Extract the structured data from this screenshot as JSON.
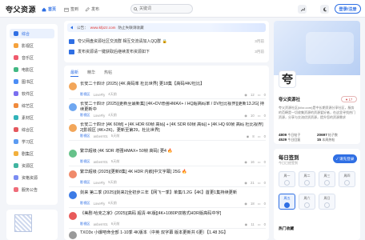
{
  "header": {
    "logo": "夸父资源",
    "nav": [
      {
        "label": "首页",
        "active": true
      },
      {
        "label": "签到",
        "active": false
      },
      {
        "label": "发布",
        "active": false
      }
    ],
    "search_placeholder": "关键词",
    "login_label": "登录/注册"
  },
  "sidebar": {
    "items": [
      {
        "label": "综合",
        "color": "#2f6fe4"
      },
      {
        "label": "影视区",
        "color": "#f5a23c"
      },
      {
        "label": "音乐区",
        "color": "#ef5b6d"
      },
      {
        "label": "电影区",
        "color": "#42b883"
      },
      {
        "label": "图书区",
        "color": "#4c8df6"
      },
      {
        "label": "软件区",
        "color": "#7a6ff0"
      },
      {
        "label": "综艺区",
        "color": "#f08a3c"
      },
      {
        "label": "素材区",
        "color": "#31b3b9"
      },
      {
        "label": "综合区",
        "color": "#e4585e"
      },
      {
        "label": "学习区",
        "color": "#5b9bf2"
      },
      {
        "label": "剧集区",
        "color": "#f2b03c"
      },
      {
        "label": "资源区",
        "color": "#40b4a0"
      },
      {
        "label": "资格资源",
        "color": "#7b8cf2"
      },
      {
        "label": "服务公告",
        "color": "#ef6d7a"
      }
    ]
  },
  "notice": {
    "bar_prefix": "公告：",
    "bar_url": "www.kfpzz.com",
    "bar_text": "防止失联请收藏",
    "rows": [
      {
        "text": "夸父网盘资源社区交流群 相互交流请加入QQ群 🔒",
        "date": "3月前"
      },
      {
        "text": "发布资源请一键获取后继续发布资源如下",
        "date": "3月前"
      }
    ]
  },
  "posts": {
    "tabs": [
      {
        "label": "最新",
        "active": true
      },
      {
        "label": "精华",
        "active": false
      },
      {
        "label": "热帖",
        "active": false
      }
    ],
    "items": [
      {
        "title": "长安二十四计 (2025) [4K 高码率 杜比世界] 更18集【高码/4K/杜比】",
        "two": false,
        "cat": "影视区",
        "user": "LoveFly",
        "time": "4天前",
        "views": "12",
        "replies": "0",
        "avatar": "#f2a65a"
      },
      {
        "title": "长安二十四计 (2025)[更新至最新集] [4K+DV增强HMAX+ / HQ超高码率 / DV杜比视界][更新13.2G] 持续更新中",
        "two": true,
        "cat": "影视区",
        "user": "LoveFly",
        "time": "4天前",
        "views": "10",
        "replies": "0",
        "avatar": "#6fa7f0"
      },
      {
        "title": "长安二十四计 [4K 60帧] + [4K HDR 60帧 高码] + [4K SDR 60帧 高码] + [4K HQ 60帧 高码 杜比视界] 2[影视区 (4K+2K)，更新至第29，杜比世界]",
        "two": true,
        "cat": "影视区",
        "user": "anberrr01",
        "time": "5天前",
        "views": "8",
        "replies": "0",
        "avatar": "#f2a65a"
      },
      {
        "title": "繁华超级 (4K SDR 增强HMAX+ 50帧 高码) 更4 🔥",
        "two": false,
        "cat": "影视区",
        "user": "anberrr01",
        "time": "5天前",
        "views": "16",
        "replies": "0",
        "avatar": "#66c28a"
      },
      {
        "title": "繁华超级 (2025)[更新8集] 4K HDR 内嵌[中文字幕] 25G 🔥",
        "two": false,
        "cat": "影视区",
        "user": "LoveFly",
        "time": "5天前",
        "views": "21",
        "replies": "0",
        "avatar": "#f08a6a"
      },
      {
        "title": "剑来 第二季 (2025)[剑来2]全初步三年【网飞一季】单集/1.2G【4K】首更1集持续更新",
        "two": false,
        "cat": "影视区",
        "user": "LoveFly",
        "time": "6天前",
        "views": "18",
        "replies": "0",
        "avatar": "#3c7be6"
      },
      {
        "title": "《美剧·哈克之家》(2025)[高码 超清 4K版][4K+1080P双格式HDR版高码中字]",
        "two": false,
        "cat": "影视区",
        "user": "anberrr01",
        "time": "6天前",
        "views": "11",
        "replies": "0",
        "avatar": "#e85a5a"
      },
      {
        "title": "TXO3x 小爆吧命全部 1-10季 4K版本（中英 双字幕 版本更新共 6更）【1.48 3G】",
        "two": false,
        "cat": "影视区",
        "user": "LoveFly",
        "time": "7天前",
        "views": "9",
        "replies": "0",
        "avatar": "#9a9a9a"
      }
    ]
  },
  "profile": {
    "avatar_char": "夸",
    "name": "夸父资源社",
    "fav_label": "♥ 17",
    "desc": "夸父资源社区(kfzz.com)是中长期资源分享社区，服务的范畴是一切收集资源的资源爱好者，在这里寻找热门资源，分享与交流优质资源，提升您的资源需求",
    "stats": [
      {
        "value": "4809",
        "label": "今日帖子"
      },
      {
        "value": "20697",
        "label": "帖子数"
      },
      {
        "value": "4529",
        "label": "今日回复"
      },
      {
        "value": "15",
        "label": "本周热帖"
      }
    ]
  },
  "signin": {
    "title": "每日签到",
    "subtitle": "今日已经签到",
    "button_label": "✓ 请先登录",
    "days": [
      {
        "label": "周一",
        "active": false
      },
      {
        "label": "周二",
        "active": false
      },
      {
        "label": "周三",
        "active": false
      },
      {
        "label": "周四",
        "active": true
      },
      {
        "label": "周五",
        "active": false
      },
      {
        "label": "周六",
        "active": false
      },
      {
        "label": "周日",
        "active": false
      }
    ],
    "hot_label": "热门收藏"
  }
}
